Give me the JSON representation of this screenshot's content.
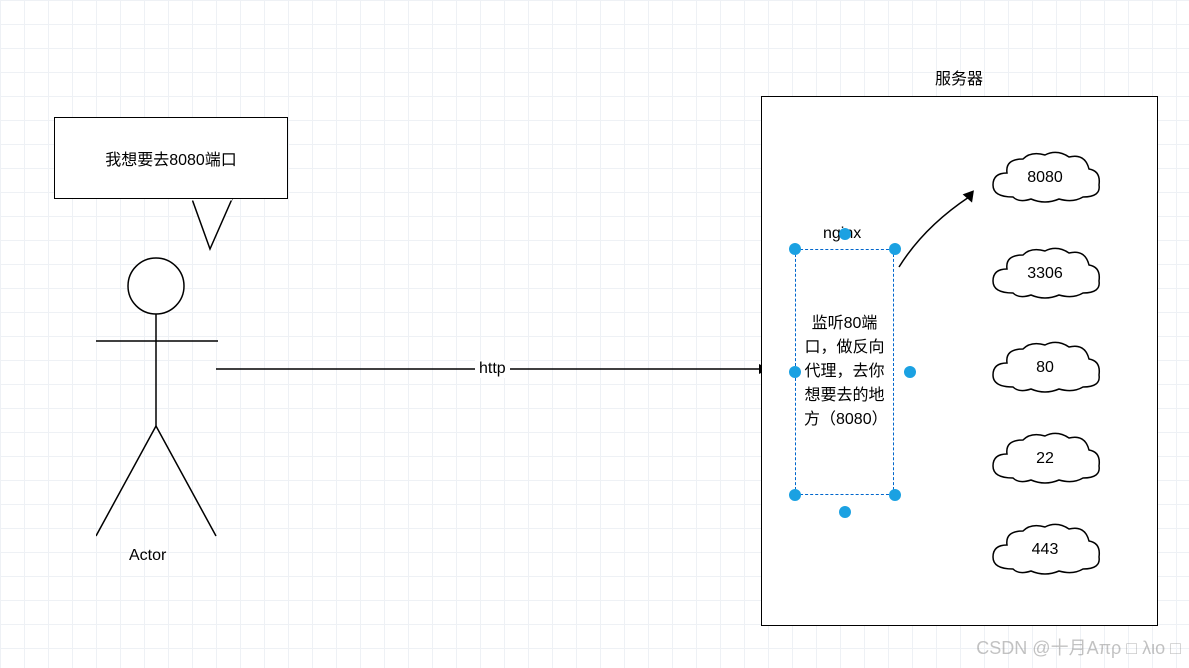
{
  "actor_label": "Actor",
  "speech": "我想要去8080端口",
  "arrow_label": "http",
  "server_label": "服务器",
  "nginx_label": "nginx",
  "nginx_text": "监听80端口，做反向代理，去你想要去的地方（8080）",
  "clouds": {
    "c1": "8080",
    "c2": "3306",
    "c3": "80",
    "c4": "22",
    "c5": "443"
  },
  "watermark": "CSDN @十月Aπρ □ λιο □"
}
